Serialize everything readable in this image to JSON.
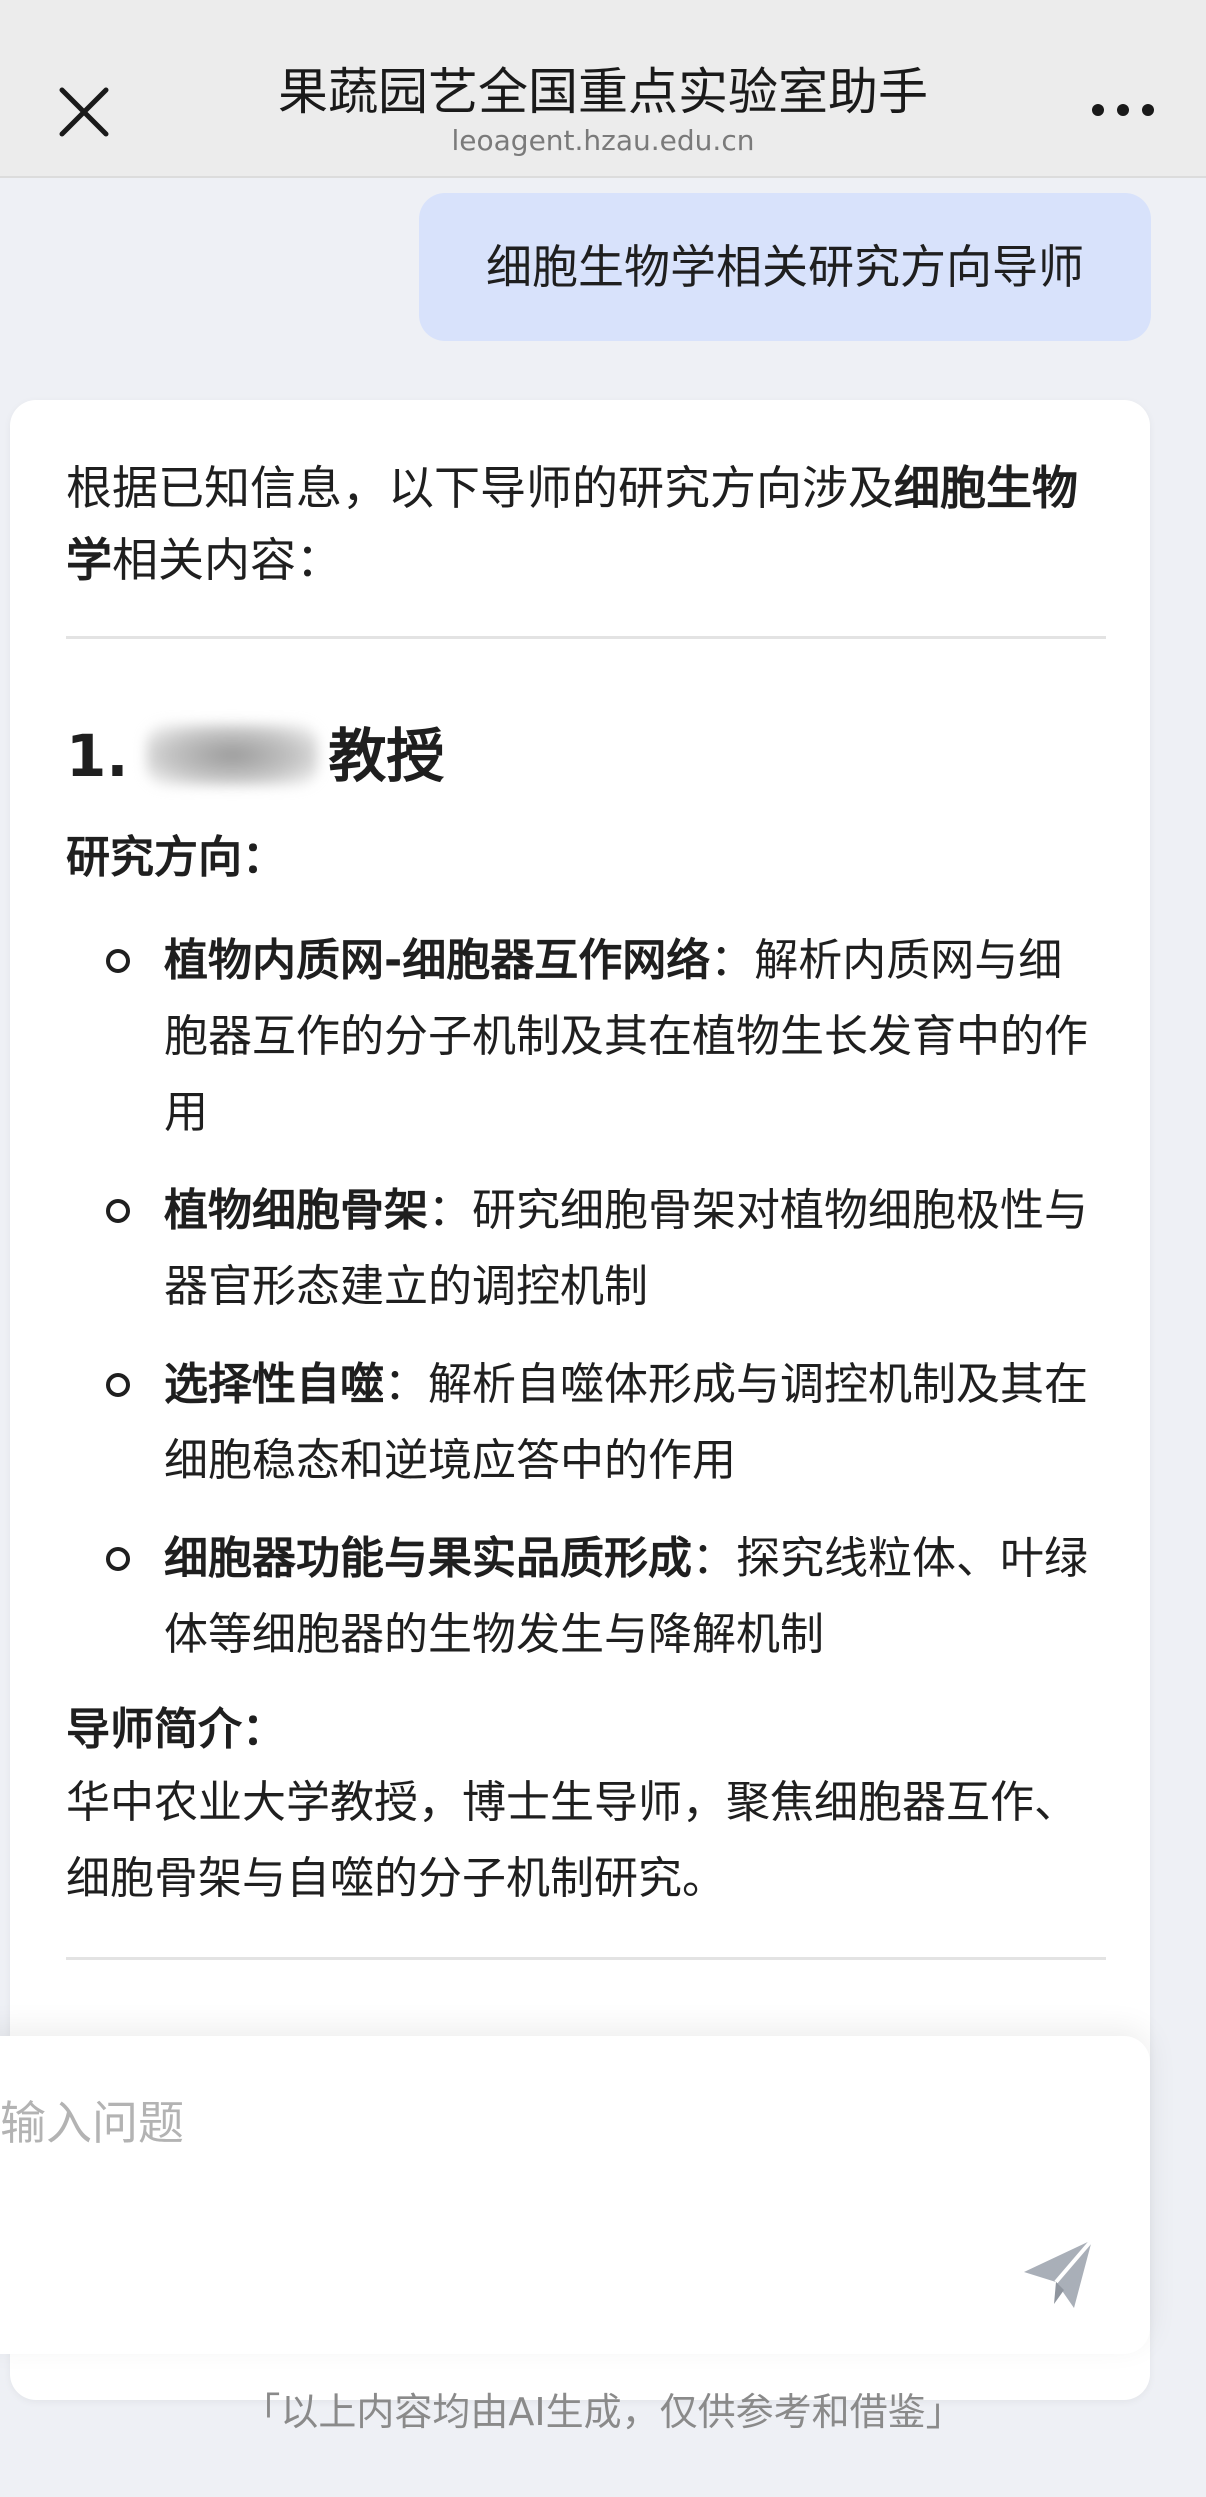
{
  "header": {
    "title": "果蔬园艺全国重点实验室助手",
    "url": "leoagent.hzau.edu.cn",
    "close_icon": "close-icon",
    "more_icon": "more-dots-icon"
  },
  "user_message": "细胞生物学相关研究方向导师",
  "answer": {
    "intro_prefix": "根据已知信息，以下导师的研究方向涉及",
    "intro_bold": "细胞生物学",
    "intro_suffix": "相关内容：",
    "section": {
      "number": "1.",
      "title_suffix": "教授",
      "research_label": "研究方向：",
      "items": [
        {
          "bold": "植物内质网-细胞器互作网络",
          "text": "：解析内质网与细胞器互作的分子机制及其在植物生长发育中的作用"
        },
        {
          "bold": "植物细胞骨架",
          "text": "：研究细胞骨架对植物细胞极性与器官形态建立的调控机制"
        },
        {
          "bold": "选择性自噬",
          "text": "：解析自噬体形成与调控机制及其在细胞稳态和逆境应答中的作用"
        },
        {
          "bold": "细胞器功能与果实品质形成",
          "text": "：探究线粒体、叶绿体等细胞器的生物发生与降解机制"
        }
      ],
      "intro_label": "导师简介：",
      "intro_text": "华中农业大学教授，博士生导师，聚焦细胞器互作、细胞骨架与自噬的分子机制研究。"
    }
  },
  "input": {
    "placeholder": "输入问题",
    "value": "",
    "send_icon": "send-icon"
  },
  "disclaimer": "「以上内容均由AI生成，仅供参考和借鉴」",
  "colors": {
    "background": "#eef0f5",
    "header": "#ececec",
    "user_bubble": "#d8e2fb",
    "card": "#ffffff",
    "muted_text": "#8a8a8a"
  }
}
